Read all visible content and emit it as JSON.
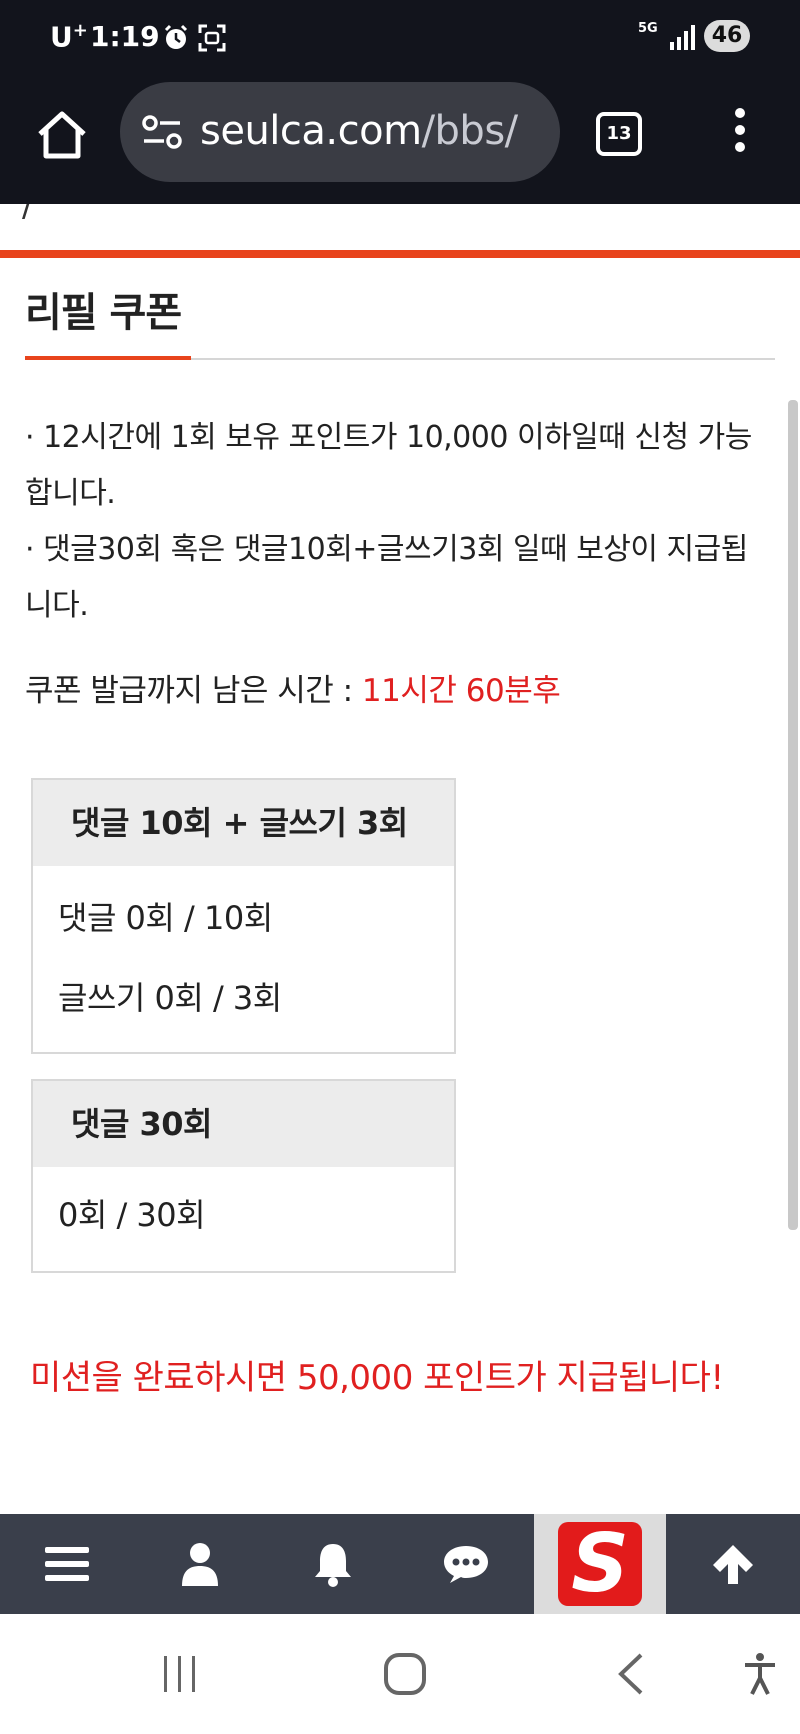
{
  "status_bar": {
    "carrier": "U",
    "carrier_sup": "+",
    "time": "1:19",
    "network": "5G",
    "battery": "46"
  },
  "browser": {
    "url_host": "seulca.com",
    "url_path": "/bbs/",
    "tab_count": "13"
  },
  "page": {
    "title": "리필 쿠폰",
    "notice_line1": "· 12시간에 1회 보유 포인트가 10,000 이하일때 신청 가능합니다.",
    "notice_line2": "· 댓글30회 혹은 댓글10회+글쓰기3회 일때 보상이 지급됩니다.",
    "remain_label": "쿠폰 발급까지 남은 시간 : ",
    "remain_value": "11시간 60분후",
    "mission_box1": {
      "title": "댓글 10회 + 글쓰기 3회",
      "row1": "댓글 0회 / 10회",
      "row2": "글쓰기 0회 / 3회"
    },
    "mission_box2": {
      "title": "댓글 30회",
      "row1": "0회 / 30회"
    },
    "mission_reward": "미션을 완료하시면 50,000 포인트가 지급됩니다!"
  },
  "bottom_bar": {
    "logo_letter": "S"
  },
  "colors": {
    "accent": "#e8441c",
    "highlight_red": "#e02020",
    "chrome_bg": "#12141c",
    "toolbar_bg": "#3a3f4b"
  }
}
